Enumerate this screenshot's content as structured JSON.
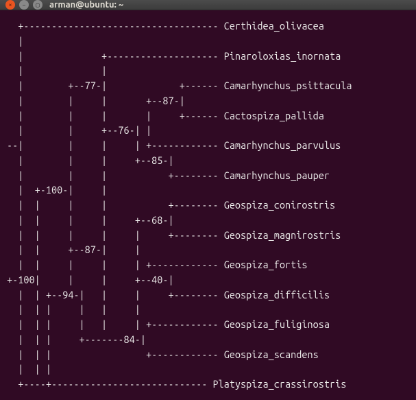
{
  "window": {
    "title": "arman@ubuntu: ~"
  },
  "terminal": {
    "lines": [
      "  +----------------------------------- Certhidea_olivacea",
      "  |",
      "  |              +-------------------- Pinaroloxias_inornata",
      "  |              |",
      "  |        +--77-|             +------ Camarhynchus_psittacula",
      "  |        |     |       +--87-|",
      "  |        |     |       |     +------ Cactospiza_pallida",
      "  |        |     +--76-| |",
      "--|        |     |     | +------------ Camarhynchus_parvulus",
      "  |        |     |     +--85-|",
      "  |        |     |           +-------- Camarhynchus_pauper",
      "  |  +-100-|     |",
      "  |  |     |     |           +-------- Geospiza_conirostris",
      "  |  |     |     |     +--68-|",
      "  |  |     |     |     |     +-------- Geospiza_magnirostris",
      "  |  |     +--87-|     |",
      "  |  |     |     |     | +------------ Geospiza_fortis",
      "+-100|     |     |     +--40-|",
      "  |  | +--94-|   |     |     +-------- Geospiza_difficilis",
      "  |  | |     |   |     |",
      "  |  | |     |   |     | +------------ Geospiza_fuliginosa",
      "  |  | |     +-------84-|",
      "  |  | |                 +------------ Geospiza_scandens",
      "  |  | |",
      "  +----+---------------------------- Platyspiza_crassirostris"
    ]
  }
}
